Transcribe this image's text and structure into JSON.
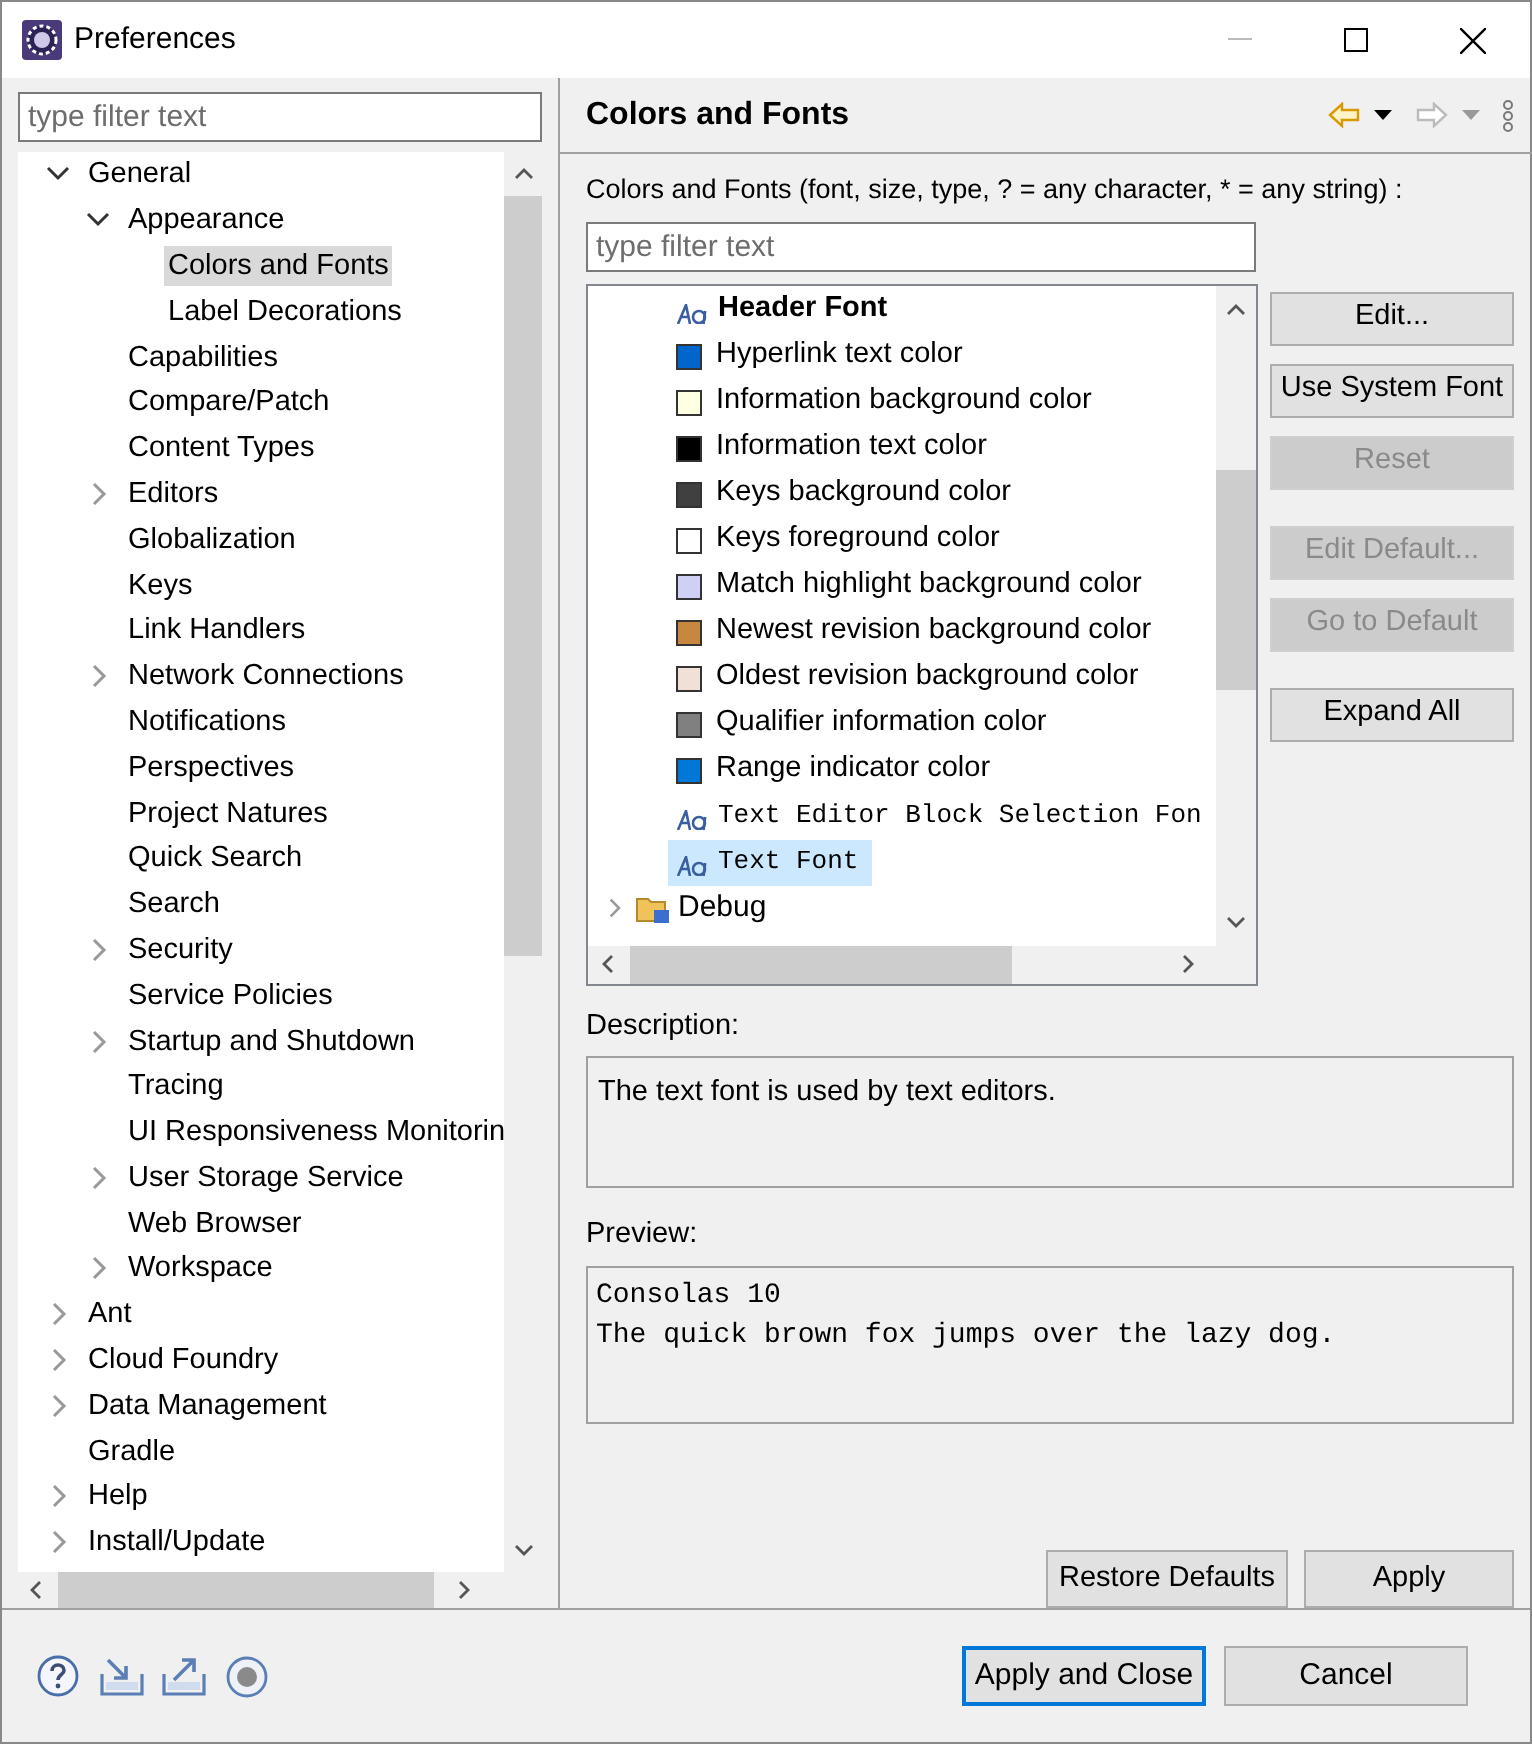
{
  "window": {
    "title": "Preferences"
  },
  "left": {
    "filter": {
      "placeholder": "type filter text"
    },
    "tree": [
      {
        "label": "General",
        "kind": "group",
        "expanded": true,
        "selected": false,
        "children": [
          {
            "label": "Appearance",
            "kind": "group",
            "expanded": true,
            "selected": false,
            "children": [
              {
                "label": "Colors and Fonts",
                "kind": "leaf",
                "selected": true
              },
              {
                "label": "Label Decorations",
                "kind": "leaf",
                "selected": false
              }
            ]
          },
          {
            "label": "Capabilities",
            "kind": "leaf",
            "selected": false
          },
          {
            "label": "Compare/Patch",
            "kind": "leaf",
            "selected": false
          },
          {
            "label": "Content Types",
            "kind": "leaf",
            "selected": false
          },
          {
            "label": "Editors",
            "kind": "group",
            "expanded": false,
            "selected": false
          },
          {
            "label": "Globalization",
            "kind": "leaf",
            "selected": false
          },
          {
            "label": "Keys",
            "kind": "leaf",
            "selected": false
          },
          {
            "label": "Link Handlers",
            "kind": "leaf",
            "selected": false
          },
          {
            "label": "Network Connections",
            "kind": "group",
            "expanded": false,
            "selected": false
          },
          {
            "label": "Notifications",
            "kind": "leaf",
            "selected": false
          },
          {
            "label": "Perspectives",
            "kind": "leaf",
            "selected": false
          },
          {
            "label": "Project Natures",
            "kind": "leaf",
            "selected": false
          },
          {
            "label": "Quick Search",
            "kind": "leaf",
            "selected": false
          },
          {
            "label": "Search",
            "kind": "leaf",
            "selected": false
          },
          {
            "label": "Security",
            "kind": "group",
            "expanded": false,
            "selected": false
          },
          {
            "label": "Service Policies",
            "kind": "leaf",
            "selected": false
          },
          {
            "label": "Startup and Shutdown",
            "kind": "group",
            "expanded": false,
            "selected": false
          },
          {
            "label": "Tracing",
            "kind": "leaf",
            "selected": false
          },
          {
            "label": "UI Responsiveness Monitorin",
            "kind": "leaf",
            "selected": false
          },
          {
            "label": "User Storage Service",
            "kind": "group",
            "expanded": false,
            "selected": false
          },
          {
            "label": "Web Browser",
            "kind": "leaf",
            "selected": false
          },
          {
            "label": "Workspace",
            "kind": "group",
            "expanded": false,
            "selected": false
          }
        ]
      },
      {
        "label": "Ant",
        "kind": "group",
        "expanded": false,
        "selected": false
      },
      {
        "label": "Cloud Foundry",
        "kind": "group",
        "expanded": false,
        "selected": false
      },
      {
        "label": "Data Management",
        "kind": "group",
        "expanded": false,
        "selected": false
      },
      {
        "label": "Gradle",
        "kind": "leaf",
        "selected": false
      },
      {
        "label": "Help",
        "kind": "group",
        "expanded": false,
        "selected": false
      },
      {
        "label": "Install/Update",
        "kind": "group",
        "expanded": false,
        "selected": false
      }
    ]
  },
  "page": {
    "title": "Colors and Fonts",
    "filter_label": "Colors and Fonts (font, size, type, ? = any character, * = any string) :",
    "filter": {
      "placeholder": "type filter text"
    },
    "items": [
      {
        "kind": "bold_font",
        "label": "Header Font",
        "selected": false
      },
      {
        "kind": "color",
        "color": "#0066cc",
        "label": "Hyperlink text color",
        "selected": false
      },
      {
        "kind": "color",
        "color": "#ffffe1",
        "label": "Information background color",
        "selected": false
      },
      {
        "kind": "color",
        "color": "#000000",
        "label": "Information text color",
        "selected": false
      },
      {
        "kind": "color",
        "color": "#404040",
        "label": "Keys background color",
        "selected": false
      },
      {
        "kind": "color",
        "color": "#ffffff",
        "label": "Keys foreground color",
        "selected": false
      },
      {
        "kind": "color",
        "color": "#d0d0f5",
        "label": "Match highlight background color",
        "selected": false
      },
      {
        "kind": "color",
        "color": "#c8873f",
        "label": "Newest revision background color",
        "selected": false
      },
      {
        "kind": "color",
        "color": "#f0e0d5",
        "label": "Oldest revision background color",
        "selected": false
      },
      {
        "kind": "color",
        "color": "#808080",
        "label": "Qualifier information color",
        "selected": false
      },
      {
        "kind": "color",
        "color": "#0078d7",
        "label": "Range indicator color",
        "selected": false
      },
      {
        "kind": "code_font",
        "label": "Text Editor Block Selection Fon",
        "selected": false
      },
      {
        "kind": "code_font",
        "label": "Text Font",
        "selected": true
      },
      {
        "kind": "category",
        "label": "Debug",
        "expanded": false,
        "selected": false
      }
    ],
    "button_groups": [
      [
        {
          "label": "Edit...",
          "disabled": false
        },
        {
          "label": "Use System Font",
          "disabled": false
        },
        {
          "label": "Reset",
          "disabled": true
        }
      ],
      [
        {
          "label": "Edit Default...",
          "disabled": true
        },
        {
          "label": "Go to Default",
          "disabled": true
        }
      ],
      [
        {
          "label": "Expand All",
          "disabled": false
        }
      ]
    ],
    "description_label": "Description:",
    "description": "The text font is used by text editors.",
    "preview_label": "Preview:",
    "preview": [
      "Consolas 10",
      "The quick brown fox jumps over the lazy dog."
    ],
    "buttons": [
      "Restore Defaults",
      "Apply"
    ]
  },
  "footer": {
    "buttons": [
      {
        "label": "Apply and Close",
        "default": true
      },
      {
        "label": "Cancel",
        "default": false
      }
    ]
  }
}
